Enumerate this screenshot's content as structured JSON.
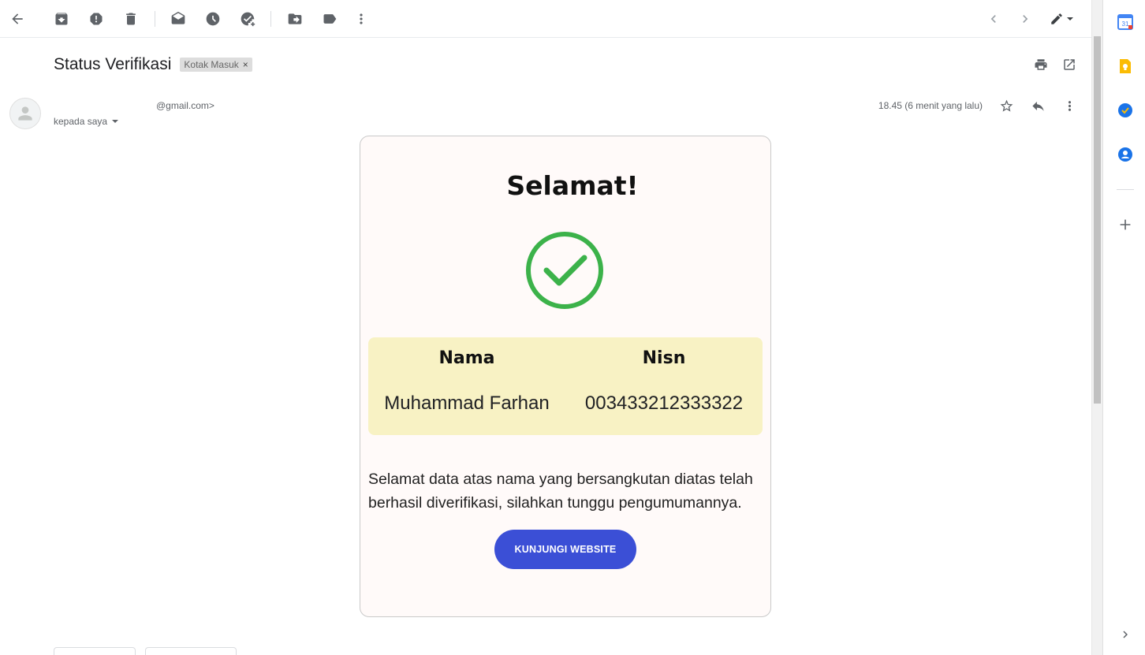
{
  "toolbar": {
    "icons": [
      "back-arrow-icon",
      "archive-icon",
      "report-spam-icon",
      "delete-icon",
      "mark-unread-icon",
      "snooze-icon",
      "add-task-icon",
      "move-to-icon",
      "label-icon",
      "more-vert-icon",
      "prev-icon",
      "next-icon",
      "input-tools-icon"
    ]
  },
  "subject": {
    "title": "Status Verifikasi",
    "label_chip": "Kotak Masuk",
    "label_remove": "×"
  },
  "sender": {
    "email_suffix": "@gmail.com>",
    "recipient_text": "kepada saya",
    "timestamp": "18.45 (6 menit yang lalu)"
  },
  "email": {
    "heading": "Selamat!",
    "table": {
      "headers": [
        "Nama",
        "Nisn"
      ],
      "values": [
        "Muhammad Farhan",
        "003433212333322"
      ]
    },
    "message": "Selamat data atas nama yang bersangkutan diatas telah berhasil diverifikasi, silahkan tunggu pengumumannya.",
    "cta_label": "KUNJUNGI WEBSITE"
  },
  "colors": {
    "check_green": "#3cb24a",
    "info_box_bg": "#f8f2c4",
    "cta_blue": "#3b4fd6",
    "card_bg": "#fffaf9"
  },
  "side_panel": {
    "apps": [
      "calendar-icon",
      "keep-icon",
      "tasks-icon",
      "contacts-icon",
      "add-app-icon",
      "expand-panel-icon"
    ],
    "calendar_day": "31"
  }
}
